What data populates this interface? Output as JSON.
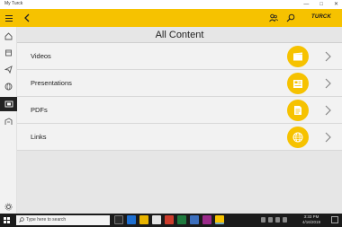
{
  "window": {
    "title": "My Turck",
    "controls": [
      "—",
      "□",
      "✕"
    ]
  },
  "appbar": {
    "brand": "TURCK",
    "color": "#f6c200"
  },
  "sidebar": {
    "items": [
      {
        "icon": "home-icon"
      },
      {
        "icon": "box-icon"
      },
      {
        "icon": "paper-plane-icon"
      },
      {
        "icon": "globe-icon"
      },
      {
        "icon": "film-icon",
        "active": true
      },
      {
        "icon": "id-card-icon"
      }
    ],
    "bottom_icon": "settings-icon"
  },
  "main": {
    "title": "All Content",
    "rows": [
      {
        "label": "Videos",
        "icon": "video-clapper-icon"
      },
      {
        "label": "Presentations",
        "icon": "presentation-icon"
      },
      {
        "label": "PDFs",
        "icon": "pdf-document-icon"
      },
      {
        "label": "Links",
        "icon": "globe-icon"
      }
    ]
  },
  "taskbar": {
    "search_placeholder": "Type here to search",
    "time": "3:33 PM",
    "date": "4/16/2019"
  }
}
